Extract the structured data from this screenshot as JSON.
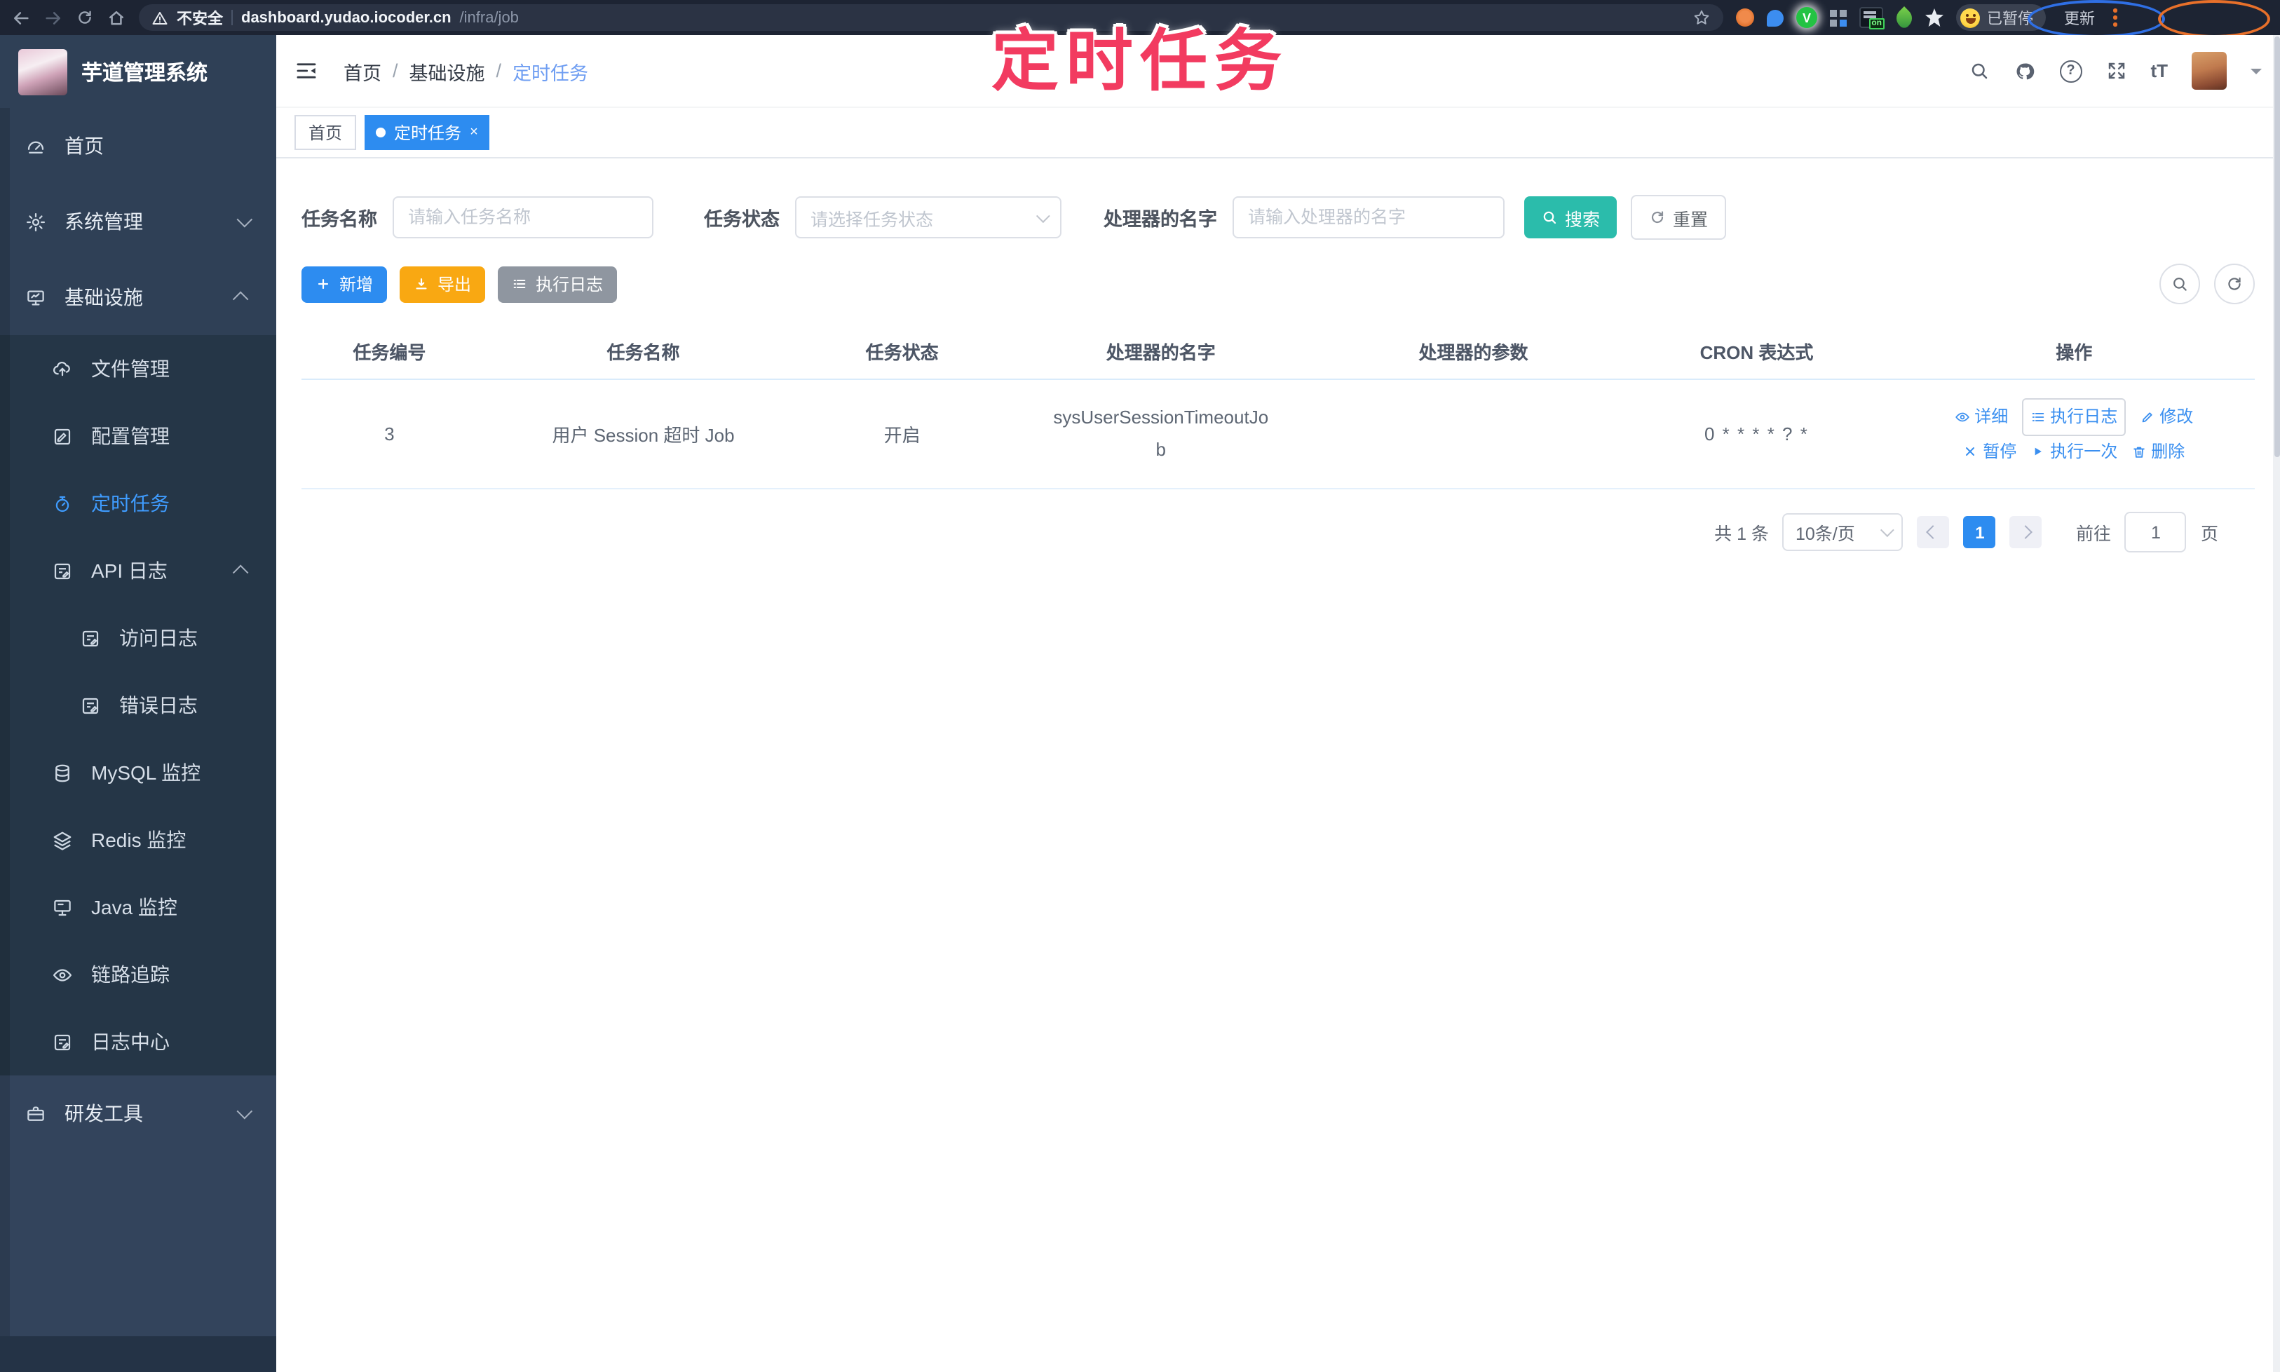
{
  "browser": {
    "security_label": "不安全",
    "url_host": "dashboard.yudao.iocoder.cn",
    "url_path": "/infra/job",
    "profile_badge": "已暂停",
    "update_label": "更新"
  },
  "annotation": {
    "title": "定时任务"
  },
  "sidebar": {
    "app_title": "芋道管理系统",
    "items": [
      {
        "label": "首页"
      },
      {
        "label": "系统管理"
      },
      {
        "label": "基础设施"
      },
      {
        "label": "文件管理"
      },
      {
        "label": "配置管理"
      },
      {
        "label": "定时任务",
        "active": true
      },
      {
        "label": "API 日志"
      },
      {
        "label": "访问日志"
      },
      {
        "label": "错误日志"
      },
      {
        "label": "MySQL 监控"
      },
      {
        "label": "Redis 监控"
      },
      {
        "label": "Java 监控"
      },
      {
        "label": "链路追踪"
      },
      {
        "label": "日志中心"
      },
      {
        "label": "研发工具"
      }
    ]
  },
  "header": {
    "breadcrumb": [
      "首页",
      "基础设施",
      "定时任务"
    ]
  },
  "tabs": [
    {
      "label": "首页",
      "active": false
    },
    {
      "label": "定时任务",
      "active": true
    }
  ],
  "filters": {
    "name_label": "任务名称",
    "name_placeholder": "请输入任务名称",
    "status_label": "任务状态",
    "status_placeholder": "请选择任务状态",
    "handler_label": "处理器的名字",
    "handler_placeholder": "请输入处理器的名字",
    "search_label": "搜索",
    "reset_label": "重置"
  },
  "toolbar": {
    "add_label": "新增",
    "export_label": "导出",
    "exec_log_label": "执行日志"
  },
  "table": {
    "columns": [
      "任务编号",
      "任务名称",
      "任务状态",
      "处理器的名字",
      "处理器的参数",
      "CRON 表达式",
      "操作"
    ],
    "row": {
      "id": "3",
      "name": "用户 Session 超时 Job",
      "status": "开启",
      "handler": "sysUserSessionTimeoutJob",
      "param": "",
      "cron": "0 * * * * ? *"
    },
    "actions": {
      "detail": "详细",
      "exec_log": "执行日志",
      "edit": "修改",
      "pause": "暂停",
      "run_once": "执行一次",
      "delete": "删除"
    }
  },
  "pagination": {
    "total": "共 1 条",
    "page_size": "10条/页",
    "current_page": "1",
    "goto_label": "前往",
    "goto_value": "1",
    "page_unit": "页"
  },
  "icons": {
    "close": "×",
    "breadcrumb_sep": "/",
    "question_mark": "?",
    "font_size": "tT",
    "ext_v": "V",
    "ext_on": "on"
  },
  "colors": {
    "accent_blue": "#2d8cf0",
    "link_blue": "#3a8ff0",
    "menu_active_blue": "#3f9cff",
    "search_teal": "#2bbcab",
    "export_orange": "#f9a812",
    "gray_button": "#8f96a0",
    "sidebar_bg": "#2f4056",
    "submenu_bg": "#253647",
    "chrome_bg": "#1d2433",
    "annotation_pink": "#f23b60",
    "annotation_orange": "#e8702a",
    "annotation_ring_blue": "#2f6fe4"
  }
}
